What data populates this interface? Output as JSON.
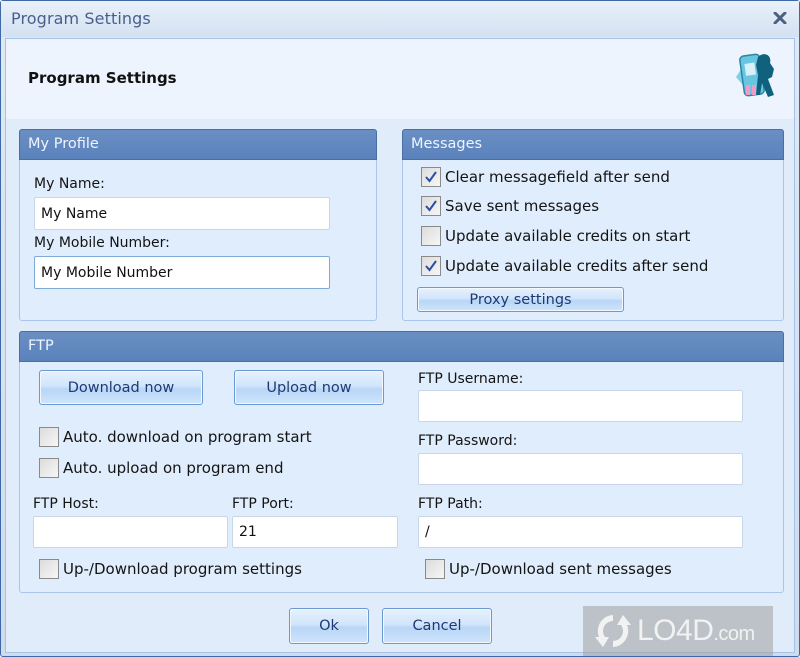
{
  "window": {
    "title": "Program Settings",
    "close_icon": "close-icon"
  },
  "header": {
    "title": "Program Settings",
    "app_icon": "phone-person-icon"
  },
  "profile": {
    "title": "My Profile",
    "name_label": "My Name:",
    "name_value": "My Name",
    "mobile_label": "My Mobile Number:",
    "mobile_value": "My Mobile Number"
  },
  "messages": {
    "title": "Messages",
    "options": [
      {
        "label": "Clear messagefield after send",
        "checked": true
      },
      {
        "label": "Save sent messages",
        "checked": true
      },
      {
        "label": "Update available credits on start",
        "checked": false
      },
      {
        "label": "Update available credits after send",
        "checked": true
      }
    ],
    "proxy_button": "Proxy settings"
  },
  "ftp": {
    "title": "FTP",
    "download_button": "Download now",
    "upload_button": "Upload now",
    "auto_download": {
      "label": "Auto. download on program start",
      "checked": false
    },
    "auto_upload": {
      "label": "Auto. upload on program end",
      "checked": false
    },
    "username_label": "FTP Username:",
    "username_value": "",
    "password_label": "FTP Password:",
    "password_value": "",
    "host_label": "FTP Host:",
    "host_value": "",
    "port_label": "FTP Port:",
    "port_value": "21",
    "path_label": "FTP Path:",
    "path_value": "/",
    "sync_settings": {
      "label": "Up-/Download program settings",
      "checked": false
    },
    "sync_messages": {
      "label": "Up-/Download sent messages",
      "checked": false
    }
  },
  "footer": {
    "ok_button": "Ok",
    "cancel_button": "Cancel"
  },
  "watermark": {
    "text": "LO4D",
    "suffix": ".com"
  }
}
